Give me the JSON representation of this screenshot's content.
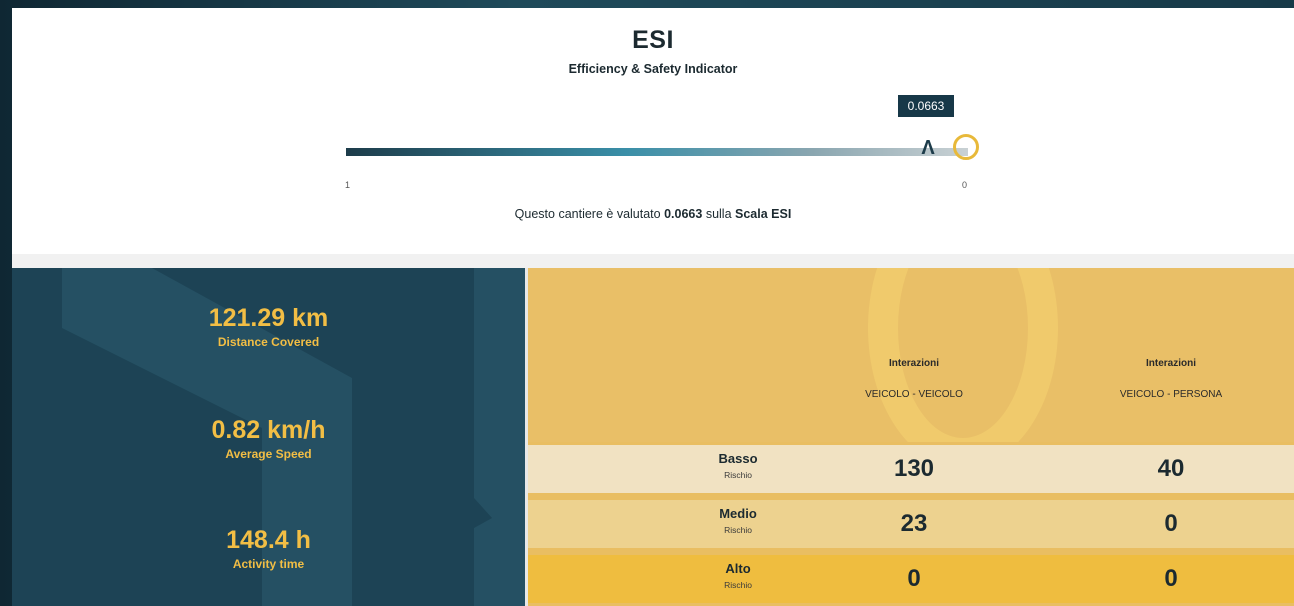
{
  "header": {
    "title": "ESI",
    "subtitle": "Efficiency & Safety Indicator"
  },
  "scale": {
    "value_label": "0.0663",
    "value": 0.0663,
    "min_label": "1",
    "max_label": "0",
    "marker_glyph": "Λ"
  },
  "rating": {
    "prefix": "Questo cantiere è valutato",
    "value": "0.0663",
    "middle": "sulla",
    "scale_name": "Scala ESI"
  },
  "stats": [
    {
      "value": "121.29 km",
      "label": "Distance Covered"
    },
    {
      "value": "0.82 km/h",
      "label": "Average Speed"
    },
    {
      "value": "148.4 h",
      "label": "Activity time"
    }
  ],
  "risk_table": {
    "columns": [
      {
        "title": "Interazioni",
        "subtitle": "VEICOLO - VEICOLO"
      },
      {
        "title": "Interazioni",
        "subtitle": "VEICOLO - PERSONA"
      }
    ],
    "rows": [
      {
        "level": "Basso",
        "sub": "Rischio",
        "values": [
          "130",
          "40"
        ],
        "color": "#f1e2c2"
      },
      {
        "level": "Medio",
        "sub": "Rischio",
        "values": [
          "23",
          "0"
        ],
        "color": "#edd28f"
      },
      {
        "level": "Alto",
        "sub": "Rischio",
        "values": [
          "0",
          "0"
        ],
        "color": "#efbd3f"
      }
    ]
  },
  "colors": {
    "accent": "#f2be45",
    "dark_panel": "#1d4355",
    "tag_bg": "#173848"
  }
}
